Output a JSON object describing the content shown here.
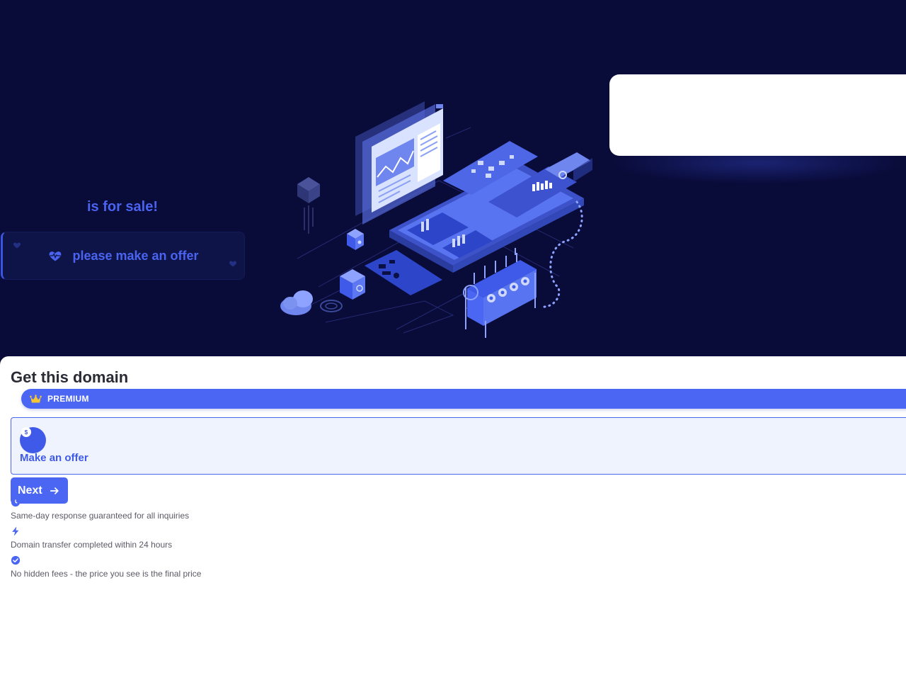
{
  "hero": {
    "for_sale_text": "is for sale!",
    "offer_banner_text": "please make an offer"
  },
  "panel": {
    "title": "Get this domain",
    "premium_label": "PREMIUM",
    "offer_option": {
      "label": "Make an offer",
      "coin_symbol": "$"
    },
    "next_button_label": "Next",
    "features": [
      {
        "icon": "clock-icon",
        "text": "Same-day response guaranteed for all inquiries"
      },
      {
        "icon": "lightning-icon",
        "text": "Domain transfer completed within 24 hours"
      },
      {
        "icon": "check-circle-icon",
        "text": "No hidden fees - the price you see is the final price"
      }
    ]
  },
  "colors": {
    "hero_bg": "#090b39",
    "accent": "#4a66f2",
    "text_dark": "#2b2b36"
  }
}
